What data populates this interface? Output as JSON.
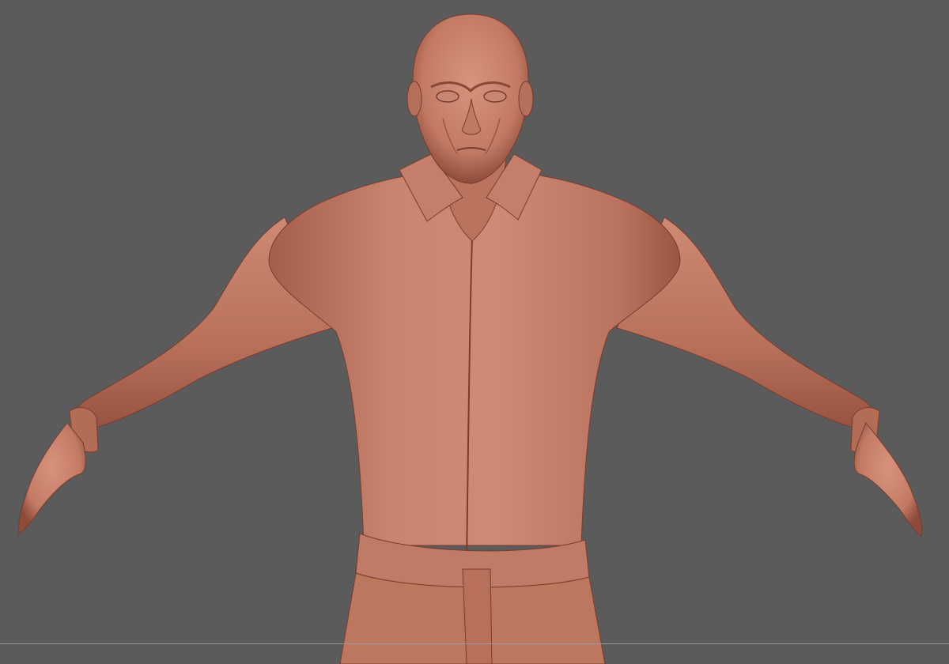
{
  "viewport": {
    "background_color": "#5b5b5b",
    "floor_line_color": "#9a9a9a"
  },
  "model": {
    "subject": "sculpted-male-figure",
    "pose": "a-pose",
    "material": "clay",
    "skin_color": "#c27a64",
    "shadow_color": "#8e4b3a",
    "highlight_color": "#d9937c",
    "outline_color": "#7a3c2d"
  }
}
